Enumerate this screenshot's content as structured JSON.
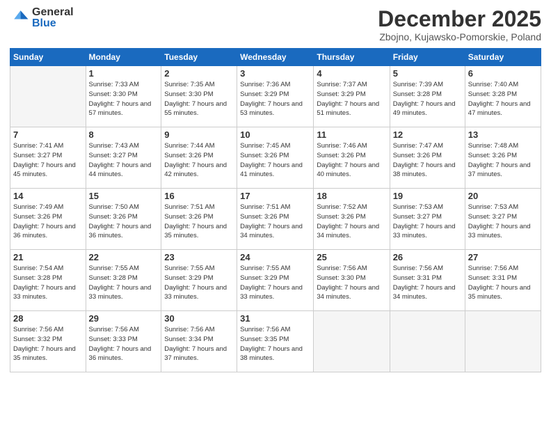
{
  "logo": {
    "general": "General",
    "blue": "Blue"
  },
  "title": "December 2025",
  "location": "Zbojno, Kujawsko-Pomorskie, Poland",
  "days_of_week": [
    "Sunday",
    "Monday",
    "Tuesday",
    "Wednesday",
    "Thursday",
    "Friday",
    "Saturday"
  ],
  "weeks": [
    [
      {
        "day": "",
        "detail": ""
      },
      {
        "day": "1",
        "detail": "Sunrise: 7:33 AM\nSunset: 3:30 PM\nDaylight: 7 hours\nand 57 minutes."
      },
      {
        "day": "2",
        "detail": "Sunrise: 7:35 AM\nSunset: 3:30 PM\nDaylight: 7 hours\nand 55 minutes."
      },
      {
        "day": "3",
        "detail": "Sunrise: 7:36 AM\nSunset: 3:29 PM\nDaylight: 7 hours\nand 53 minutes."
      },
      {
        "day": "4",
        "detail": "Sunrise: 7:37 AM\nSunset: 3:29 PM\nDaylight: 7 hours\nand 51 minutes."
      },
      {
        "day": "5",
        "detail": "Sunrise: 7:39 AM\nSunset: 3:28 PM\nDaylight: 7 hours\nand 49 minutes."
      },
      {
        "day": "6",
        "detail": "Sunrise: 7:40 AM\nSunset: 3:28 PM\nDaylight: 7 hours\nand 47 minutes."
      }
    ],
    [
      {
        "day": "7",
        "detail": "Sunrise: 7:41 AM\nSunset: 3:27 PM\nDaylight: 7 hours\nand 45 minutes."
      },
      {
        "day": "8",
        "detail": "Sunrise: 7:43 AM\nSunset: 3:27 PM\nDaylight: 7 hours\nand 44 minutes."
      },
      {
        "day": "9",
        "detail": "Sunrise: 7:44 AM\nSunset: 3:26 PM\nDaylight: 7 hours\nand 42 minutes."
      },
      {
        "day": "10",
        "detail": "Sunrise: 7:45 AM\nSunset: 3:26 PM\nDaylight: 7 hours\nand 41 minutes."
      },
      {
        "day": "11",
        "detail": "Sunrise: 7:46 AM\nSunset: 3:26 PM\nDaylight: 7 hours\nand 40 minutes."
      },
      {
        "day": "12",
        "detail": "Sunrise: 7:47 AM\nSunset: 3:26 PM\nDaylight: 7 hours\nand 38 minutes."
      },
      {
        "day": "13",
        "detail": "Sunrise: 7:48 AM\nSunset: 3:26 PM\nDaylight: 7 hours\nand 37 minutes."
      }
    ],
    [
      {
        "day": "14",
        "detail": "Sunrise: 7:49 AM\nSunset: 3:26 PM\nDaylight: 7 hours\nand 36 minutes."
      },
      {
        "day": "15",
        "detail": "Sunrise: 7:50 AM\nSunset: 3:26 PM\nDaylight: 7 hours\nand 36 minutes."
      },
      {
        "day": "16",
        "detail": "Sunrise: 7:51 AM\nSunset: 3:26 PM\nDaylight: 7 hours\nand 35 minutes."
      },
      {
        "day": "17",
        "detail": "Sunrise: 7:51 AM\nSunset: 3:26 PM\nDaylight: 7 hours\nand 34 minutes."
      },
      {
        "day": "18",
        "detail": "Sunrise: 7:52 AM\nSunset: 3:26 PM\nDaylight: 7 hours\nand 34 minutes."
      },
      {
        "day": "19",
        "detail": "Sunrise: 7:53 AM\nSunset: 3:27 PM\nDaylight: 7 hours\nand 33 minutes."
      },
      {
        "day": "20",
        "detail": "Sunrise: 7:53 AM\nSunset: 3:27 PM\nDaylight: 7 hours\nand 33 minutes."
      }
    ],
    [
      {
        "day": "21",
        "detail": "Sunrise: 7:54 AM\nSunset: 3:28 PM\nDaylight: 7 hours\nand 33 minutes."
      },
      {
        "day": "22",
        "detail": "Sunrise: 7:55 AM\nSunset: 3:28 PM\nDaylight: 7 hours\nand 33 minutes."
      },
      {
        "day": "23",
        "detail": "Sunrise: 7:55 AM\nSunset: 3:29 PM\nDaylight: 7 hours\nand 33 minutes."
      },
      {
        "day": "24",
        "detail": "Sunrise: 7:55 AM\nSunset: 3:29 PM\nDaylight: 7 hours\nand 33 minutes."
      },
      {
        "day": "25",
        "detail": "Sunrise: 7:56 AM\nSunset: 3:30 PM\nDaylight: 7 hours\nand 34 minutes."
      },
      {
        "day": "26",
        "detail": "Sunrise: 7:56 AM\nSunset: 3:31 PM\nDaylight: 7 hours\nand 34 minutes."
      },
      {
        "day": "27",
        "detail": "Sunrise: 7:56 AM\nSunset: 3:31 PM\nDaylight: 7 hours\nand 35 minutes."
      }
    ],
    [
      {
        "day": "28",
        "detail": "Sunrise: 7:56 AM\nSunset: 3:32 PM\nDaylight: 7 hours\nand 35 minutes."
      },
      {
        "day": "29",
        "detail": "Sunrise: 7:56 AM\nSunset: 3:33 PM\nDaylight: 7 hours\nand 36 minutes."
      },
      {
        "day": "30",
        "detail": "Sunrise: 7:56 AM\nSunset: 3:34 PM\nDaylight: 7 hours\nand 37 minutes."
      },
      {
        "day": "31",
        "detail": "Sunrise: 7:56 AM\nSunset: 3:35 PM\nDaylight: 7 hours\nand 38 minutes."
      },
      {
        "day": "",
        "detail": ""
      },
      {
        "day": "",
        "detail": ""
      },
      {
        "day": "",
        "detail": ""
      }
    ]
  ]
}
